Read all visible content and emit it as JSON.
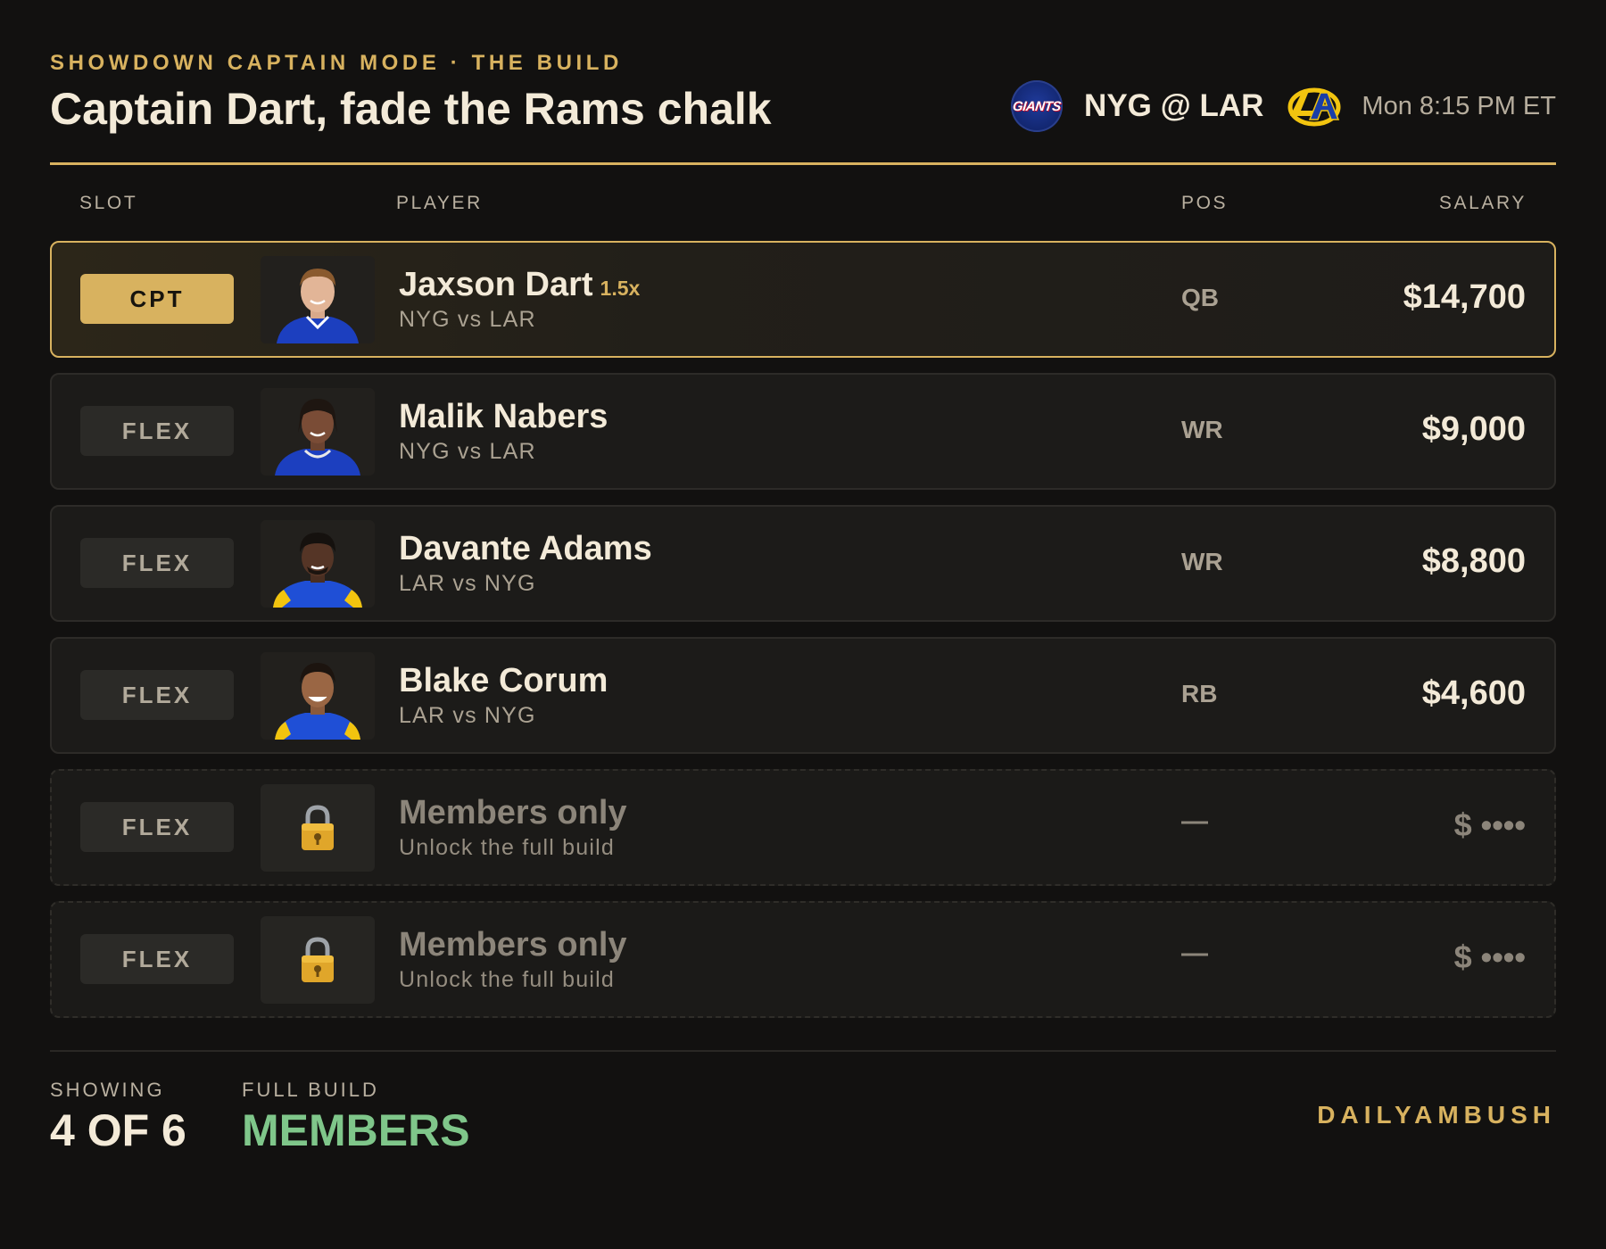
{
  "header": {
    "eyebrow": "SHOWDOWN CAPTAIN MODE · THE BUILD",
    "title": "Captain Dart, fade the Rams chalk",
    "home_logo_icon": "giants-logo-icon",
    "home_logo_text": "GIANTS",
    "matchup": "NYG @ LAR",
    "away_logo_icon": "rams-logo-icon",
    "kickoff": "Mon 8:15 PM ET"
  },
  "columns": {
    "slot": "SLOT",
    "player": "PLAYER",
    "pos": "POS",
    "salary": "SALARY"
  },
  "rows": [
    {
      "slot": "CPT",
      "name": "Jaxson Dart",
      "multiplier": "1.5x",
      "sub": "NYG vs LAR",
      "pos": "QB",
      "salary": "$14,700",
      "jersey_color": "#1c3fbf"
    },
    {
      "slot": "FLEX",
      "name": "Malik Nabers",
      "sub": "NYG vs LAR",
      "pos": "WR",
      "salary": "$9,000",
      "jersey_color": "#1c3fbf"
    },
    {
      "slot": "FLEX",
      "name": "Davante Adams",
      "sub": "LAR vs NYG",
      "pos": "WR",
      "salary": "$8,800",
      "jersey_color": "#1f4fd6"
    },
    {
      "slot": "FLEX",
      "name": "Blake Corum",
      "sub": "LAR vs NYG",
      "pos": "RB",
      "salary": "$4,600",
      "jersey_color": "#1f4fd6"
    },
    {
      "slot": "FLEX",
      "name": "Members only",
      "sub": "Unlock the full build",
      "pos": "—",
      "salary": "$ ••••",
      "icon": "lock-icon"
    },
    {
      "slot": "FLEX",
      "name": "Members only",
      "sub": "Unlock the full build",
      "pos": "—",
      "salary": "$ ••••",
      "icon": "lock-icon"
    }
  ],
  "footer": {
    "showing_label": "SHOWING",
    "showing_value": "4 OF 6",
    "full_label": "FULL BUILD",
    "full_value": "MEMBERS",
    "brand": "DAILYAMBUSH"
  },
  "colors": {
    "background": "#121110",
    "accent_gold": "#d8b25f",
    "members_green": "#7fc68a",
    "text_primary": "#f3ead8"
  }
}
